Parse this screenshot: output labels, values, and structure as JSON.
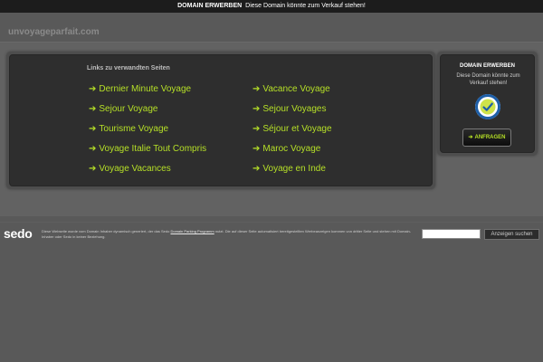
{
  "topbar": {
    "strong_text": "DOMAIN ERWERBEN",
    "text": "Diese Domain könnte zum Verkauf stehen!"
  },
  "site": {
    "name": "unvoyageparfait.com"
  },
  "links": {
    "heading": "Links zu verwandten Seiten",
    "arrow": "➔",
    "left": [
      "Dernier Minute Voyage",
      "Sejour Voyage",
      "Tourisme Voyage",
      "Voyage Italie Tout Compris",
      "Voyage Vacances"
    ],
    "right": [
      "Vacance Voyage",
      "Sejour Voyages",
      "Séjour et Voyage",
      "Maroc Voyage",
      "Voyage en Inde"
    ]
  },
  "sidebox": {
    "title": "DOMAIN ERWERBEN",
    "desc": "Diese Domain könnte zum Verkauf stehen!",
    "seal_icon": "trust-seal-icon",
    "button_label": "ANFRAGEN"
  },
  "footer": {
    "logo": "sedo",
    "disclaimer_before": "Diese Webseite wurde vom Domain Inhaber dynamisch generiert, der das Sedo",
    "disclaimer_link": "Domain Parking Programm",
    "disclaimer_after": "nutzt. Die auf dieser Seite automatisiert bereitgestellten Werbeanzeigen kommen von dritter Seite und stehen mit Domain-Inhaber oder Sedo in keiner Beziehung.",
    "search_value": "",
    "search_button": "Anzeigen suchen"
  },
  "colors": {
    "background": "#595959",
    "topbar": "#1c1c1c",
    "panel": "#2e2e2e",
    "link": "#b6e027"
  }
}
